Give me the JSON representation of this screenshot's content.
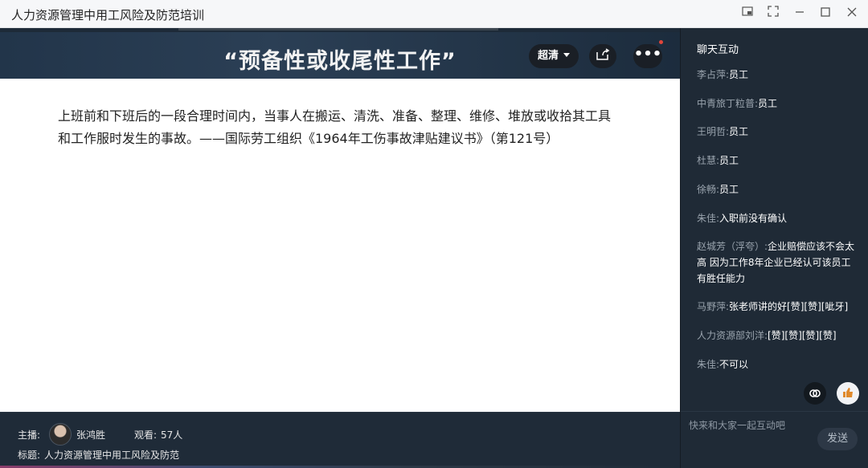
{
  "window": {
    "title": "人力资源管理中用工风险及防范培训"
  },
  "slide": {
    "title": "“预备性或收尾性工作”",
    "body_line1": "上班前和下班后的一段合理时间内，当事人在搬运、清洗、准备、整理、维修、堆放或收拾其工具",
    "body_line2": "和工作服时发生的事故。——国际劳工组织《1964年工伤事故津贴建议书》（第121号）"
  },
  "player": {
    "quality_label": "超清",
    "more_label": "•••"
  },
  "info": {
    "host_label": "主播:",
    "host_name": "张鸿胜",
    "viewers_label": "观看:",
    "viewers_value": "57人",
    "topic_label": "标题:",
    "topic_value": "人力资源管理中用工风险及防范"
  },
  "chat": {
    "header": "聊天互动",
    "messages": [
      {
        "user": "李占萍:",
        "text": "员工"
      },
      {
        "user": "中青旅丁粒普:",
        "text": "员工"
      },
      {
        "user": "王明哲:",
        "text": "员工"
      },
      {
        "user": "杜慧:",
        "text": "员工"
      },
      {
        "user": "徐畅:",
        "text": "员工"
      },
      {
        "user": "朱佳:",
        "text": "入职前没有确认"
      },
      {
        "user": "赵城芳（浮夸）:",
        "text": "企业赔偿应该不会太高 因为工作8年企业已经认可该员工有胜任能力"
      },
      {
        "user": "马野萍:",
        "text": "张老师讲的好[赞][赞][呲牙]"
      },
      {
        "user": "人力资源部刘洋:",
        "text": "[赞][赞][赞][赞]"
      },
      {
        "user": "朱佳:",
        "text": "不可以"
      }
    ],
    "input_placeholder": "快来和大家一起互动吧",
    "send_label": "发送"
  },
  "icons": {
    "window_controls": [
      "pip-icon",
      "fullscreen-icon",
      "minimize-icon",
      "maximize-icon",
      "close-icon"
    ]
  }
}
